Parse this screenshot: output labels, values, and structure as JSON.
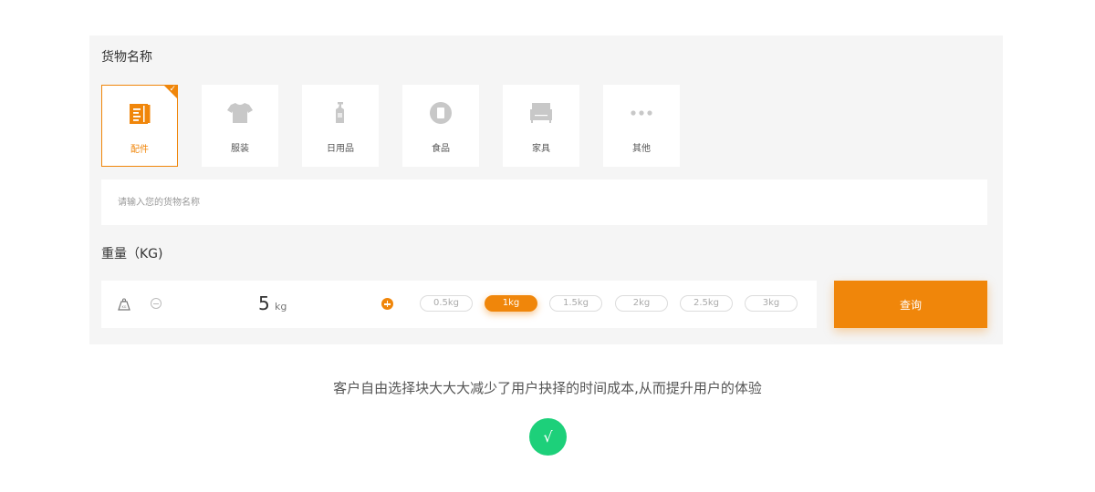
{
  "goods": {
    "title": "货物名称",
    "categories": [
      {
        "label": "配件",
        "icon": "notebook-icon",
        "selected": true
      },
      {
        "label": "服装",
        "icon": "tshirt-icon",
        "selected": false
      },
      {
        "label": "日用品",
        "icon": "spray-bottle-icon",
        "selected": false
      },
      {
        "label": "食品",
        "icon": "food-icon",
        "selected": false
      },
      {
        "label": "家具",
        "icon": "armchair-icon",
        "selected": false
      },
      {
        "label": "其他",
        "icon": "more-dots-icon",
        "selected": false
      }
    ],
    "input_placeholder": "请输入您的货物名称"
  },
  "weight": {
    "title": "重量（KG)",
    "value": "5",
    "unit": "kg",
    "presets": [
      "0.5kg",
      "1kg",
      "1.5kg",
      "2kg",
      "2.5kg",
      "3kg"
    ],
    "selected_preset": "1kg"
  },
  "query_label": "查询",
  "caption": "客户自由选择块大大大减少了用户抉择的时间成本,从而提升用户的体验",
  "check_symbol": "√",
  "colors": {
    "accent": "#f0860a",
    "panel_bg": "#f5f5f5",
    "success": "#1dd07a",
    "icon_gray": "#c8c8c8"
  }
}
